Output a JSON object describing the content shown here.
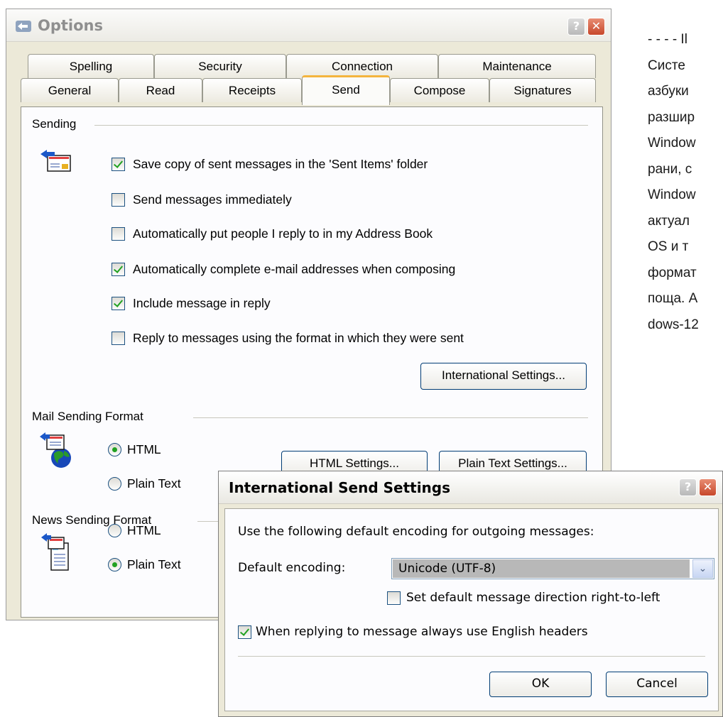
{
  "background_text": [
    "- - - - Il",
    "Систе",
    "азбуки",
    "разшир",
    "Window",
    "рани, с",
    "Window",
    "актуал",
    "OS и т",
    "формат",
    "поща. А",
    "dows-12"
  ],
  "options_window": {
    "title": "Options",
    "help_btn": "?",
    "close_btn": "✕",
    "tabs_row1": [
      "Spelling",
      "Security",
      "Connection",
      "Maintenance"
    ],
    "tabs_row2": [
      "General",
      "Read",
      "Receipts",
      "Send",
      "Compose",
      "Signatures"
    ],
    "active_tab": "Send",
    "sending": {
      "label": "Sending",
      "options": [
        {
          "label": "Save copy of sent messages in the 'Sent Items' folder",
          "checked": true
        },
        {
          "label": "Send messages immediately",
          "checked": false
        },
        {
          "label": "Automatically put people I reply to in my Address Book",
          "checked": false
        },
        {
          "label": "Automatically complete e-mail addresses when composing",
          "checked": true
        },
        {
          "label": "Include message in reply",
          "checked": true
        },
        {
          "label": "Reply to messages using the format in which they were sent",
          "checked": false
        }
      ],
      "international_button": "International Settings..."
    },
    "mail_format": {
      "label": "Mail Sending Format",
      "html": "HTML",
      "plain": "Plain Text",
      "selected": "HTML",
      "html_settings_button": "HTML Settings...",
      "plain_settings_button": "Plain Text Settings..."
    },
    "news_format": {
      "label": "News Sending Format",
      "html": "HTML",
      "plain": "Plain Text",
      "selected": "Plain Text"
    }
  },
  "intl_dialog": {
    "title": "International Send Settings",
    "help_btn": "?",
    "close_btn": "✕",
    "intro": "Use the following default encoding for outgoing messages:",
    "encoding_label": "Default encoding:",
    "encoding_value": "Unicode (UTF-8)",
    "dropdown_arrow": "⌄",
    "rtl_label": "Set default message direction right-to-left",
    "rtl_checked": false,
    "english_headers_label": "When replying to message always use English headers",
    "english_headers_checked": true,
    "ok_button": "OK",
    "cancel_button": "Cancel"
  },
  "colors": {
    "window_bg": "#ece9d8",
    "tab_accent": "#f4b43d",
    "check_green": "#21a121",
    "close_red": "#c7472b",
    "button_border": "#003c74"
  }
}
